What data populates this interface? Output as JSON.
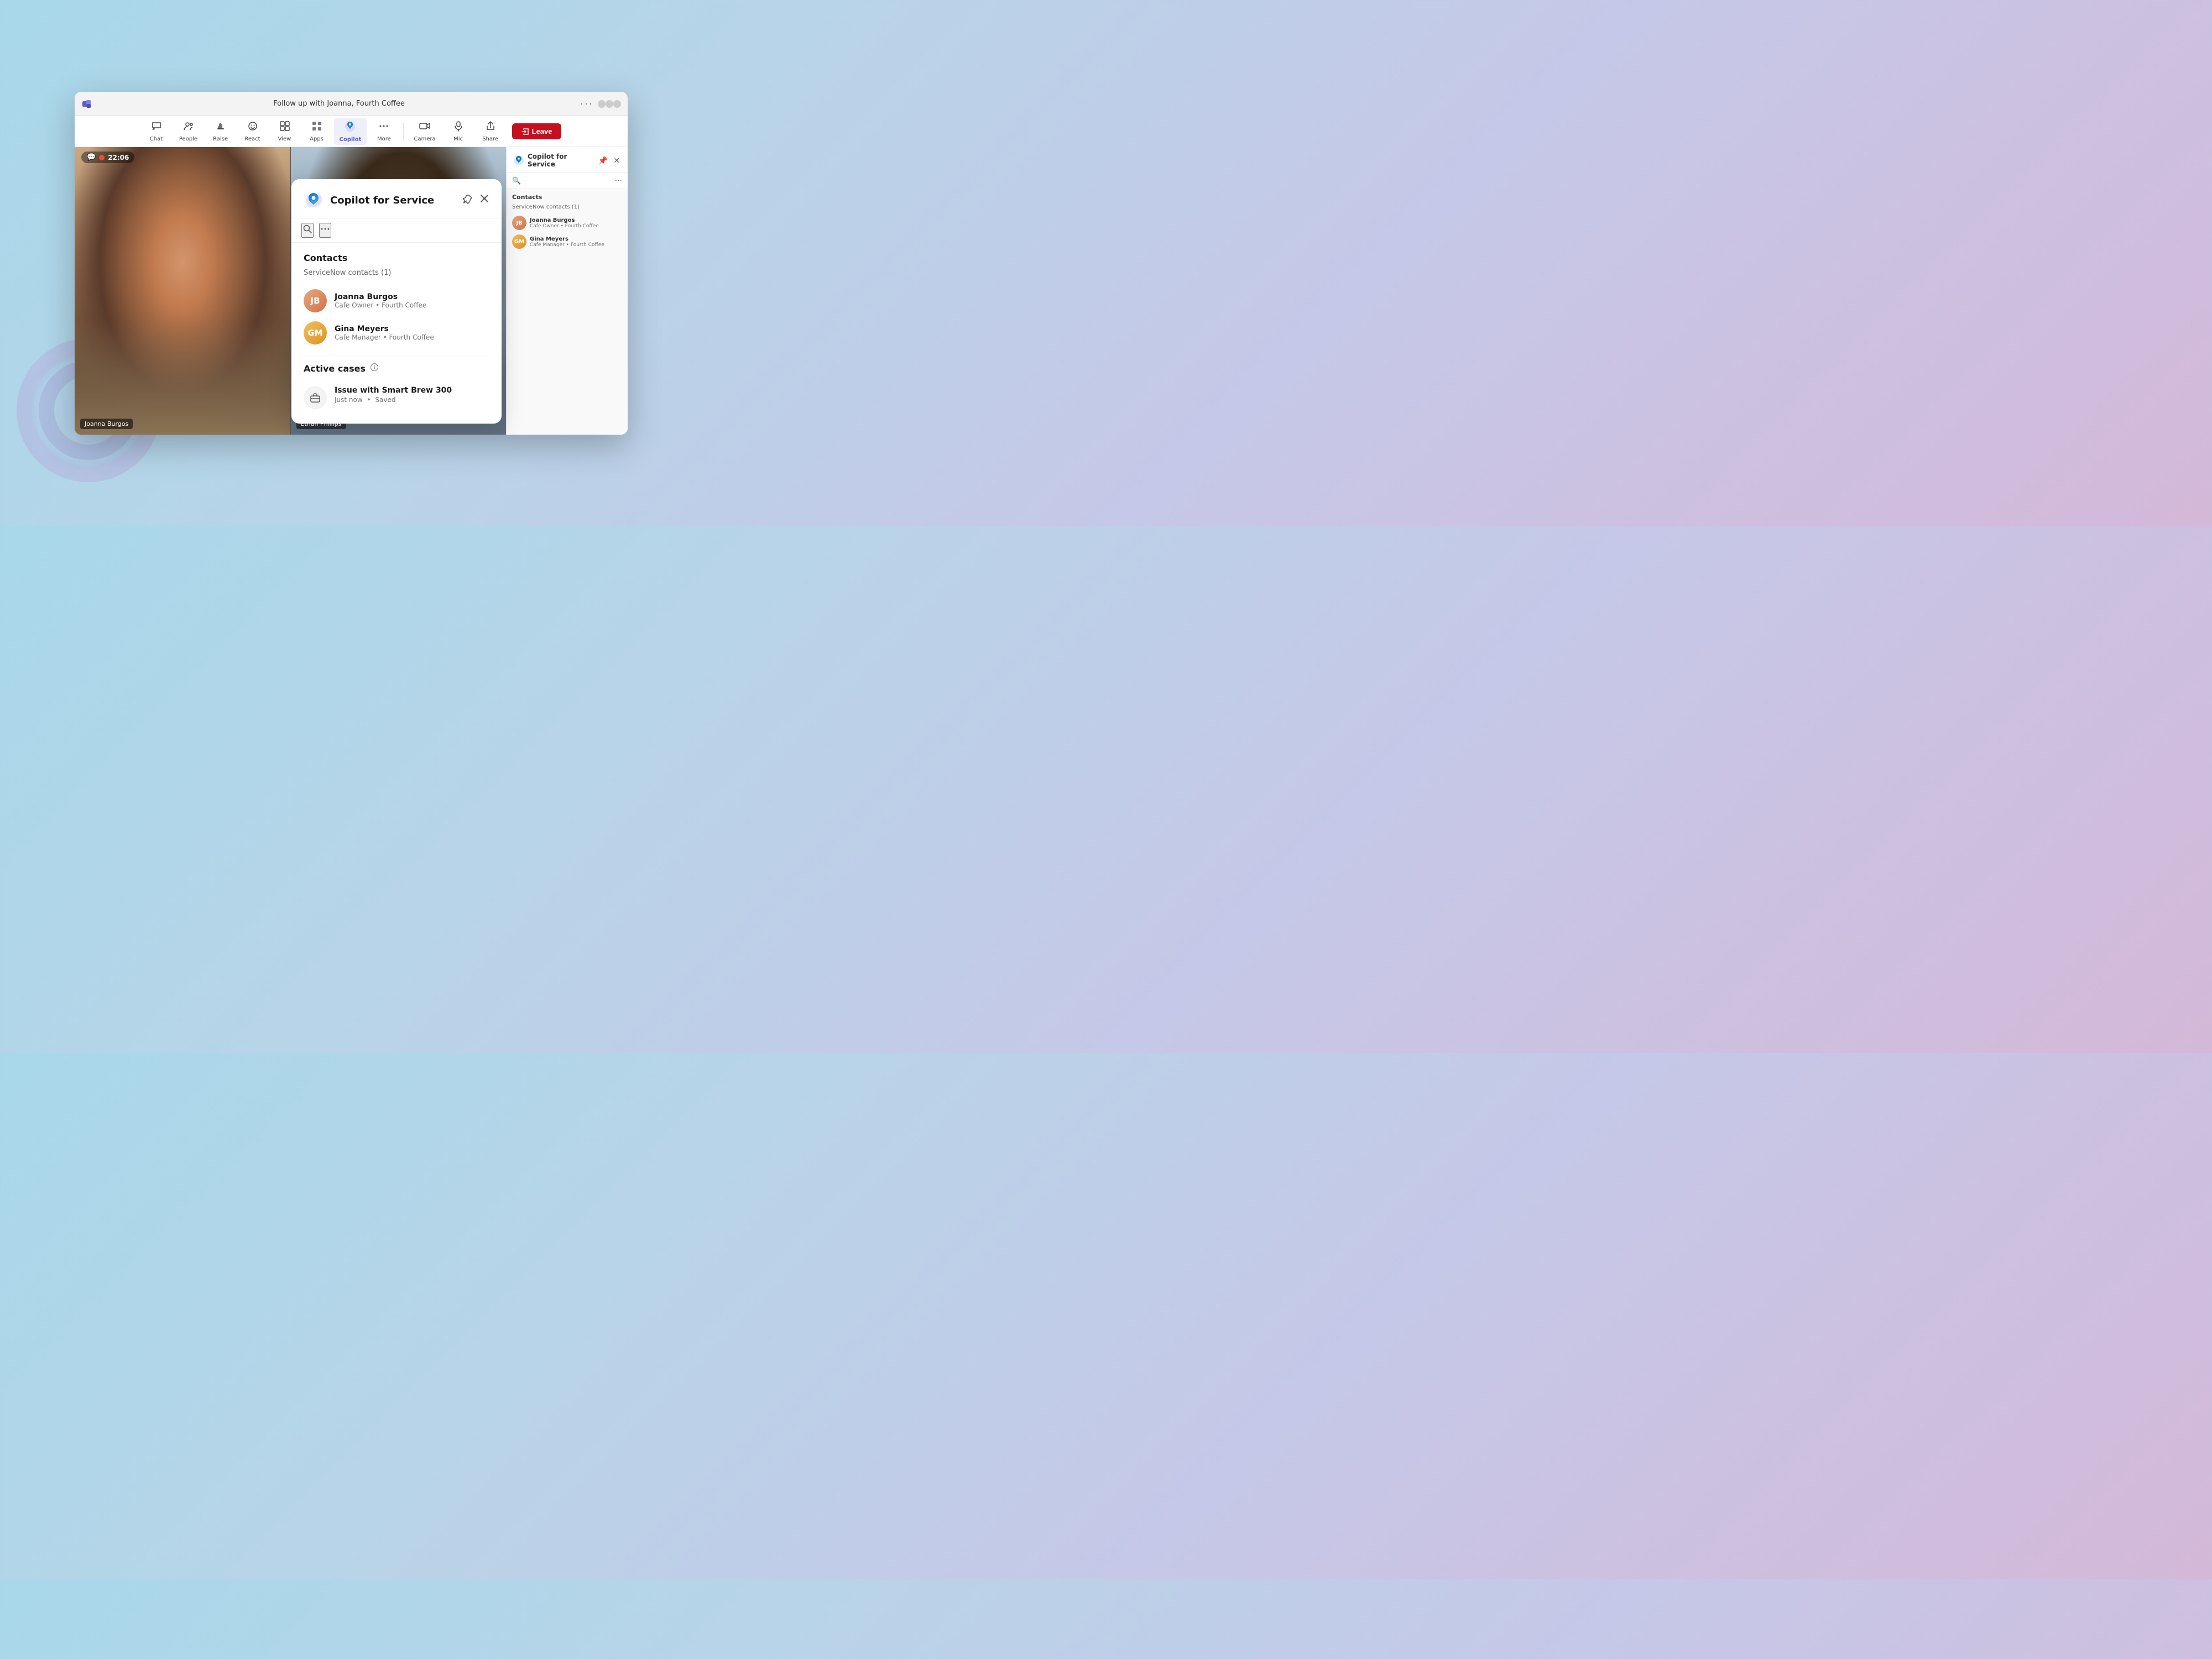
{
  "background": {
    "color_start": "#a8d8ea",
    "color_end": "#d4b8d8"
  },
  "teams_window": {
    "title": "Follow up with Joanna, Fourth Coffee",
    "recording_time": "22:06"
  },
  "toolbar": {
    "items": [
      {
        "id": "chat",
        "label": "Chat",
        "icon": "💬"
      },
      {
        "id": "people",
        "label": "People",
        "icon": "👥"
      },
      {
        "id": "raise",
        "label": "Raise",
        "icon": "✋"
      },
      {
        "id": "react",
        "label": "React",
        "icon": "😊"
      },
      {
        "id": "view",
        "label": "View",
        "icon": "⬛"
      },
      {
        "id": "apps",
        "label": "Apps",
        "icon": "⊞"
      },
      {
        "id": "copilot",
        "label": "Copilot",
        "icon": "✦",
        "active": true
      },
      {
        "id": "more",
        "label": "More",
        "icon": "···"
      },
      {
        "id": "camera",
        "label": "Camera",
        "icon": "📷"
      },
      {
        "id": "mic",
        "label": "Mic",
        "icon": "🎙"
      },
      {
        "id": "share",
        "label": "Share",
        "icon": "⬆"
      }
    ],
    "leave_label": "Leave"
  },
  "video": {
    "left_person": "Joanna Burgos",
    "right_person": "Ethan Phillips"
  },
  "side_panel": {
    "title": "Copilot for Service",
    "section_title": "Contacts",
    "sub_title": "ServiceNow contacts (1)",
    "contacts": [
      {
        "name": "Joanna Burgos",
        "role": "Cafe Owner • Fourth Coffee",
        "initials": "JB"
      },
      {
        "name": "Gina Meyers",
        "role": "Cafe Manager • Fourth Coffee",
        "initials": "GM"
      }
    ]
  },
  "copilot_panel": {
    "title": "Copilot for Service",
    "contacts_section": {
      "title": "Contacts",
      "sub_title": "ServiceNow contacts (1)",
      "contacts": [
        {
          "name": "Joanna Burgos",
          "role": "Cafe Owner • Fourth Coffee",
          "initials": "JB"
        },
        {
          "name": "Gina Meyers",
          "role": "Cafe Manager • Fourth Coffee",
          "initials": "GM"
        }
      ]
    },
    "active_cases_section": {
      "title": "Active cases",
      "cases": [
        {
          "name": "Issue with Smart Brew 300",
          "time": "Just now",
          "status": "Saved"
        }
      ]
    }
  }
}
